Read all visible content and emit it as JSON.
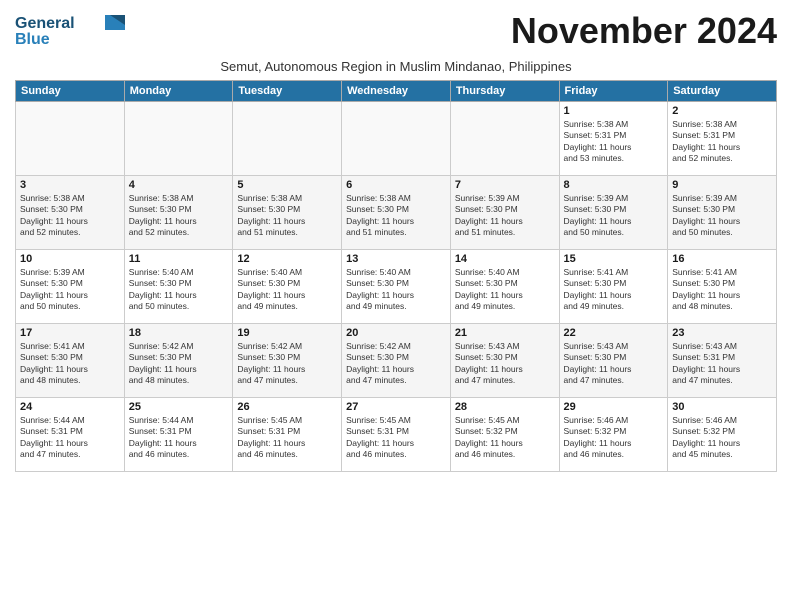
{
  "header": {
    "logo_line1": "General",
    "logo_line2": "Blue",
    "month_title": "November 2024",
    "subtitle": "Semut, Autonomous Region in Muslim Mindanao, Philippines"
  },
  "weekdays": [
    "Sunday",
    "Monday",
    "Tuesday",
    "Wednesday",
    "Thursday",
    "Friday",
    "Saturday"
  ],
  "weeks": [
    [
      {
        "day": "",
        "text": ""
      },
      {
        "day": "",
        "text": ""
      },
      {
        "day": "",
        "text": ""
      },
      {
        "day": "",
        "text": ""
      },
      {
        "day": "",
        "text": ""
      },
      {
        "day": "1",
        "text": "Sunrise: 5:38 AM\nSunset: 5:31 PM\nDaylight: 11 hours\nand 53 minutes."
      },
      {
        "day": "2",
        "text": "Sunrise: 5:38 AM\nSunset: 5:31 PM\nDaylight: 11 hours\nand 52 minutes."
      }
    ],
    [
      {
        "day": "3",
        "text": "Sunrise: 5:38 AM\nSunset: 5:30 PM\nDaylight: 11 hours\nand 52 minutes."
      },
      {
        "day": "4",
        "text": "Sunrise: 5:38 AM\nSunset: 5:30 PM\nDaylight: 11 hours\nand 52 minutes."
      },
      {
        "day": "5",
        "text": "Sunrise: 5:38 AM\nSunset: 5:30 PM\nDaylight: 11 hours\nand 51 minutes."
      },
      {
        "day": "6",
        "text": "Sunrise: 5:38 AM\nSunset: 5:30 PM\nDaylight: 11 hours\nand 51 minutes."
      },
      {
        "day": "7",
        "text": "Sunrise: 5:39 AM\nSunset: 5:30 PM\nDaylight: 11 hours\nand 51 minutes."
      },
      {
        "day": "8",
        "text": "Sunrise: 5:39 AM\nSunset: 5:30 PM\nDaylight: 11 hours\nand 50 minutes."
      },
      {
        "day": "9",
        "text": "Sunrise: 5:39 AM\nSunset: 5:30 PM\nDaylight: 11 hours\nand 50 minutes."
      }
    ],
    [
      {
        "day": "10",
        "text": "Sunrise: 5:39 AM\nSunset: 5:30 PM\nDaylight: 11 hours\nand 50 minutes."
      },
      {
        "day": "11",
        "text": "Sunrise: 5:40 AM\nSunset: 5:30 PM\nDaylight: 11 hours\nand 50 minutes."
      },
      {
        "day": "12",
        "text": "Sunrise: 5:40 AM\nSunset: 5:30 PM\nDaylight: 11 hours\nand 49 minutes."
      },
      {
        "day": "13",
        "text": "Sunrise: 5:40 AM\nSunset: 5:30 PM\nDaylight: 11 hours\nand 49 minutes."
      },
      {
        "day": "14",
        "text": "Sunrise: 5:40 AM\nSunset: 5:30 PM\nDaylight: 11 hours\nand 49 minutes."
      },
      {
        "day": "15",
        "text": "Sunrise: 5:41 AM\nSunset: 5:30 PM\nDaylight: 11 hours\nand 49 minutes."
      },
      {
        "day": "16",
        "text": "Sunrise: 5:41 AM\nSunset: 5:30 PM\nDaylight: 11 hours\nand 48 minutes."
      }
    ],
    [
      {
        "day": "17",
        "text": "Sunrise: 5:41 AM\nSunset: 5:30 PM\nDaylight: 11 hours\nand 48 minutes."
      },
      {
        "day": "18",
        "text": "Sunrise: 5:42 AM\nSunset: 5:30 PM\nDaylight: 11 hours\nand 48 minutes."
      },
      {
        "day": "19",
        "text": "Sunrise: 5:42 AM\nSunset: 5:30 PM\nDaylight: 11 hours\nand 47 minutes."
      },
      {
        "day": "20",
        "text": "Sunrise: 5:42 AM\nSunset: 5:30 PM\nDaylight: 11 hours\nand 47 minutes."
      },
      {
        "day": "21",
        "text": "Sunrise: 5:43 AM\nSunset: 5:30 PM\nDaylight: 11 hours\nand 47 minutes."
      },
      {
        "day": "22",
        "text": "Sunrise: 5:43 AM\nSunset: 5:30 PM\nDaylight: 11 hours\nand 47 minutes."
      },
      {
        "day": "23",
        "text": "Sunrise: 5:43 AM\nSunset: 5:31 PM\nDaylight: 11 hours\nand 47 minutes."
      }
    ],
    [
      {
        "day": "24",
        "text": "Sunrise: 5:44 AM\nSunset: 5:31 PM\nDaylight: 11 hours\nand 47 minutes."
      },
      {
        "day": "25",
        "text": "Sunrise: 5:44 AM\nSunset: 5:31 PM\nDaylight: 11 hours\nand 46 minutes."
      },
      {
        "day": "26",
        "text": "Sunrise: 5:45 AM\nSunset: 5:31 PM\nDaylight: 11 hours\nand 46 minutes."
      },
      {
        "day": "27",
        "text": "Sunrise: 5:45 AM\nSunset: 5:31 PM\nDaylight: 11 hours\nand 46 minutes."
      },
      {
        "day": "28",
        "text": "Sunrise: 5:45 AM\nSunset: 5:32 PM\nDaylight: 11 hours\nand 46 minutes."
      },
      {
        "day": "29",
        "text": "Sunrise: 5:46 AM\nSunset: 5:32 PM\nDaylight: 11 hours\nand 46 minutes."
      },
      {
        "day": "30",
        "text": "Sunrise: 5:46 AM\nSunset: 5:32 PM\nDaylight: 11 hours\nand 45 minutes."
      }
    ]
  ]
}
